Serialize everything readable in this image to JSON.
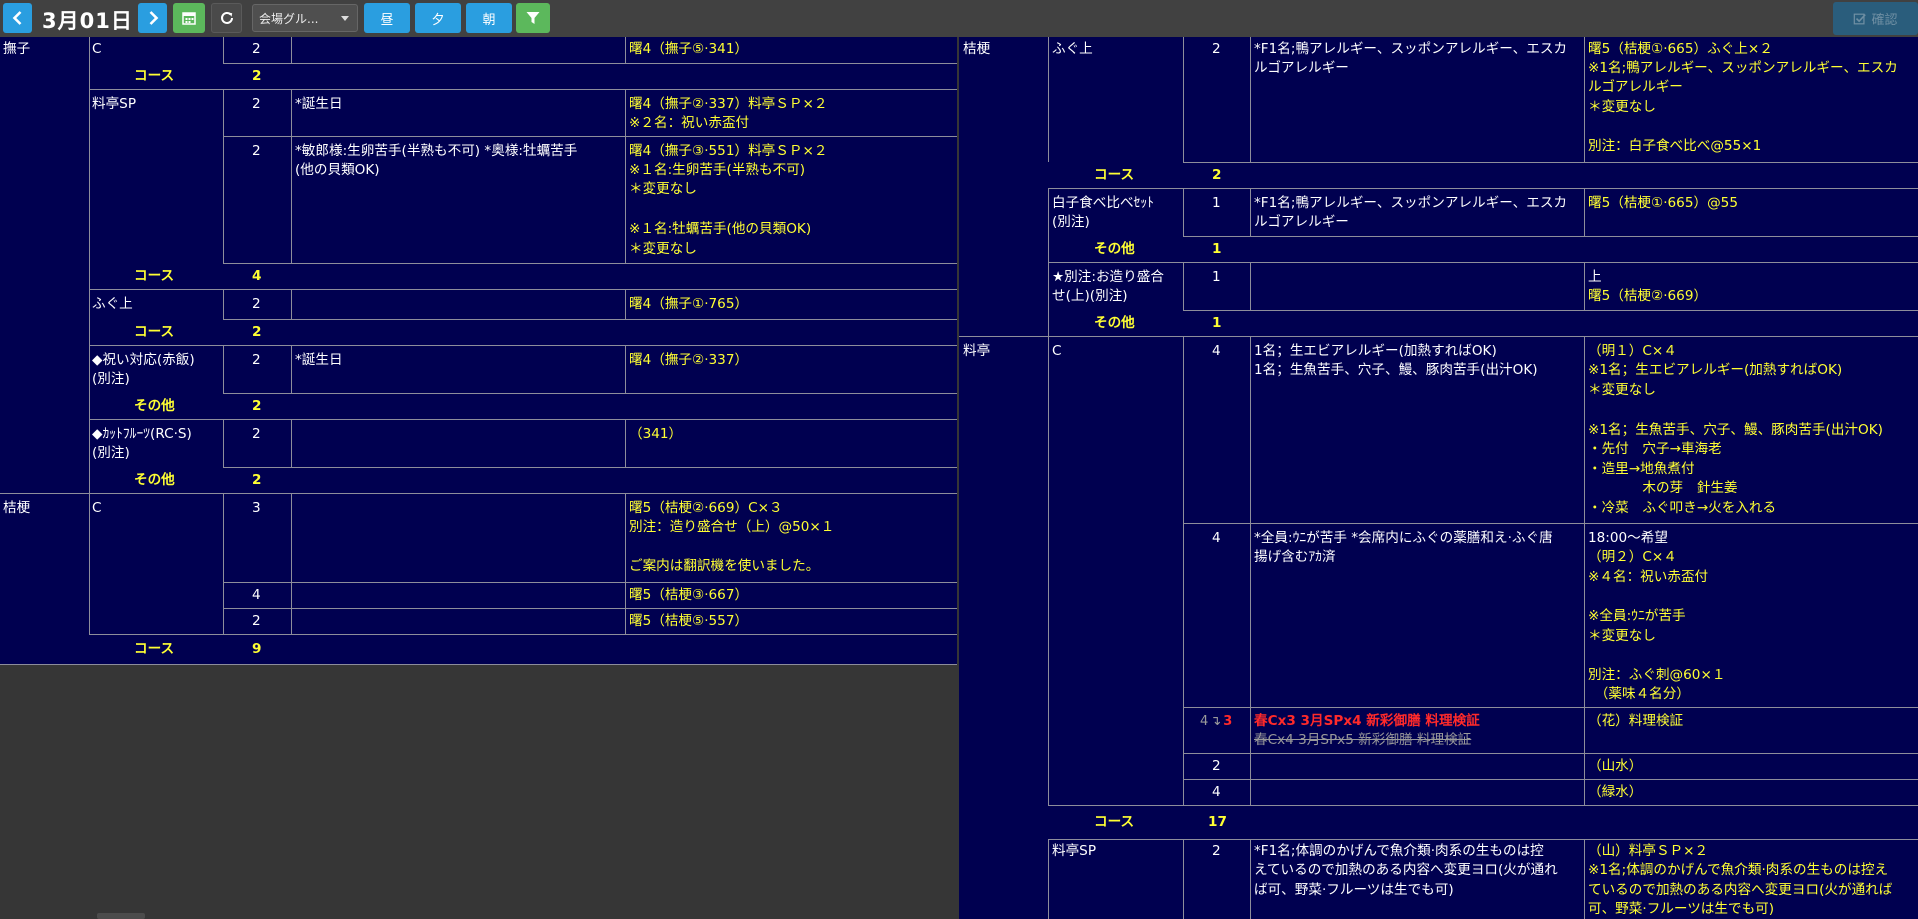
{
  "toolbar": {
    "date": "3月01日",
    "venue_group": "会場グル...",
    "btn_lunch": "昼",
    "btn_dinner": "夕",
    "btn_morning": "朝",
    "btn_confirm": "確認"
  },
  "left": {
    "rows": [
      {
        "room": "撫子",
        "course": "C",
        "qty": "2",
        "note": "",
        "detail": "曙4（撫子⑤·341）"
      },
      {
        "sub_label": "コース",
        "sub_qty": "2"
      },
      {
        "course": "料亭SP",
        "qty": "2",
        "note": "*誕生日",
        "detail": [
          "曙4（撫子②·337）料亭ＳＰ×２",
          "※２名：祝い赤盃付"
        ]
      },
      {
        "qty": "2",
        "note": [
          "*敏郎様:生卵苦手(半熟も不可) *奥様:牡蠣苦手",
          "(他の貝類OK)"
        ],
        "detail": [
          "曙4（撫子③·551）料亭ＳＰ×２",
          "※１名:生卵苦手(半熟も不可)",
          "＊変更なし",
          "",
          "※１名:牡蠣苦手(他の貝類OK)",
          "＊変更なし"
        ]
      },
      {
        "sub_label": "コース",
        "sub_qty": "4"
      },
      {
        "course": "ふぐ上",
        "qty": "2",
        "note": "",
        "detail": "曙4（撫子①·765）"
      },
      {
        "sub_label": "コース",
        "sub_qty": "2"
      },
      {
        "course": [
          "◆祝い対応(赤飯)",
          "(別注)"
        ],
        "qty": "2",
        "note": "*誕生日",
        "detail": "曙4（撫子②·337）"
      },
      {
        "sub_label": "その他",
        "sub_qty": "2"
      },
      {
        "course": [
          "◆ｶｯﾄﾌﾙｰﾂ(RC·S)",
          "(別注)"
        ],
        "qty": "2",
        "note": "",
        "detail": "（341）"
      },
      {
        "sub_label": "その他",
        "sub_qty": "2"
      },
      {
        "room": "桔梗",
        "course": "C",
        "qty": "3",
        "note": "",
        "detail": [
          "曙5（桔梗②·669）C×３",
          "別注：造り盛合せ（上）@50×１",
          "",
          "ご案内は翻訳機を使いました。"
        ]
      },
      {
        "qty": "4",
        "note": "",
        "detail": "曙5（桔梗③·667）"
      },
      {
        "qty": "2",
        "note": "",
        "detail": "曙5（桔梗⑤·557）"
      },
      {
        "sub_label": "コース",
        "sub_qty": "9"
      }
    ]
  },
  "right": {
    "rows": [
      {
        "room": "桔梗",
        "course": "ふぐ上",
        "qty": "2",
        "note": [
          "*F1名;鴨アレルギー、スッポンアレルギー、エスカ",
          "ルゴアレルギー"
        ],
        "detail": [
          "曙5（桔梗①·665）ふぐ上×２",
          "※1名;鴨アレルギー、スッポンアレルギー、エスカ",
          "ルゴアレルギー",
          "＊変更なし",
          "",
          "別注：白子食べ比べ@55×1"
        ]
      },
      {
        "sub_label": "コース",
        "sub_qty": "2"
      },
      {
        "course": [
          "白子食べ比べｾｯﾄ",
          "(別注)"
        ],
        "qty": "1",
        "note": [
          "*F1名;鴨アレルギー、スッポンアレルギー、エスカ",
          "ルゴアレルギー"
        ],
        "detail": "曙5（桔梗①·665）@55"
      },
      {
        "sub_label": "その他",
        "sub_qty": "1"
      },
      {
        "course": [
          "★別注:お造り盛合",
          "せ(上)(別注)"
        ],
        "qty": "1",
        "note": "",
        "detail": [
          "上",
          "曙5（桔梗②·669）"
        ]
      },
      {
        "sub_label": "その他",
        "sub_qty": "1"
      },
      {
        "room": "料亭",
        "course": "C",
        "qty": "4",
        "note": [
          "1名；生エビアレルギー(加熱すればOK)",
          "1名；生魚苦手、穴子、鰻、豚肉苦手(出汁OK)"
        ],
        "detail": [
          "（明１）C×４",
          "※1名；生エビアレルギー(加熱すればOK)",
          "＊変更なし",
          "",
          "※1名；生魚苦手、穴子、鰻、豚肉苦手(出汁OK)",
          "・先付　穴子→車海老",
          "・造里→地魚煮付",
          "　　　　木の芽　針生姜",
          "・冷菜　ふぐ叩き→火を入れる"
        ]
      },
      {
        "qty": "4",
        "note": [
          "*全員:ｳﾆが苦手 *会席内にふぐの薬膳和え·ふぐ唐",
          "揚げ含むｱｶ済"
        ],
        "detail": [
          "18:00～希望",
          "（明２）C×４",
          "※４名：祝い赤盃付",
          "",
          "※全員:ｳﾆが苦手",
          "＊変更なし",
          "",
          "別注：ふぐ刺@60×１",
          "　（薬味４名分）"
        ]
      },
      {
        "qty_old": "4",
        "qty_arrow": "↴",
        "qty_new": "3",
        "note_new": "春Cx3 3月SPx4 新彩御膳 料理検証",
        "note_old": "春Cx4 3月SPx5 新彩御膳 料理検証",
        "detail": "（花）料理検証"
      },
      {
        "qty": "2",
        "note": "",
        "detail": "（山水）"
      },
      {
        "qty": "4",
        "note": "",
        "detail": "（緑水）"
      },
      {
        "sub_label": "コース",
        "sub_qty": "17"
      },
      {
        "course": "料亭SP",
        "qty": "2",
        "note": [
          "*F1名;体調のかげんで魚介類·肉系の生ものは控",
          "えているので加熱のある内容へ変更ヨロ(火が通れ",
          "ば可、野菜·フルーツは生でも可)"
        ],
        "detail": [
          "（山）料亭ＳＰ×２",
          "※1名;体調のかげんで魚介類·肉系の生ものは控え",
          "ているので加熱のある内容へ変更ヨロ(火が通れば",
          "可、野菜·フルーツは生でも可)"
        ]
      }
    ]
  }
}
